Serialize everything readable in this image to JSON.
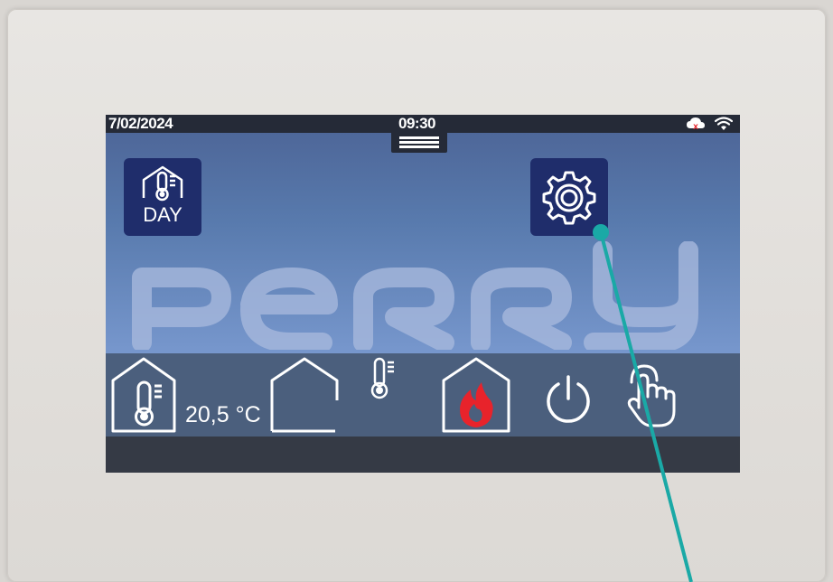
{
  "status_bar": {
    "date": "7/02/2024",
    "time": "09:30",
    "icons": [
      "cloud-alert-icon",
      "wifi-icon"
    ]
  },
  "logo": {
    "text": "PERRY"
  },
  "tiles": {
    "day_mode": {
      "icon": "house-thermometer-icon",
      "label": "DAY"
    },
    "settings": {
      "icon": "gear-icon"
    }
  },
  "bottom_bar": {
    "room_temperature": "20,5 °C",
    "icons": [
      "house-thermometer-icon",
      "house-outline-icon",
      "thermometer-icon",
      "house-flame-icon",
      "power-icon",
      "touch-hand-icon"
    ]
  },
  "colors": {
    "accent_pointer": "#1aa9a6",
    "tile": "#1f2d6b",
    "flame": "#e8232b"
  }
}
